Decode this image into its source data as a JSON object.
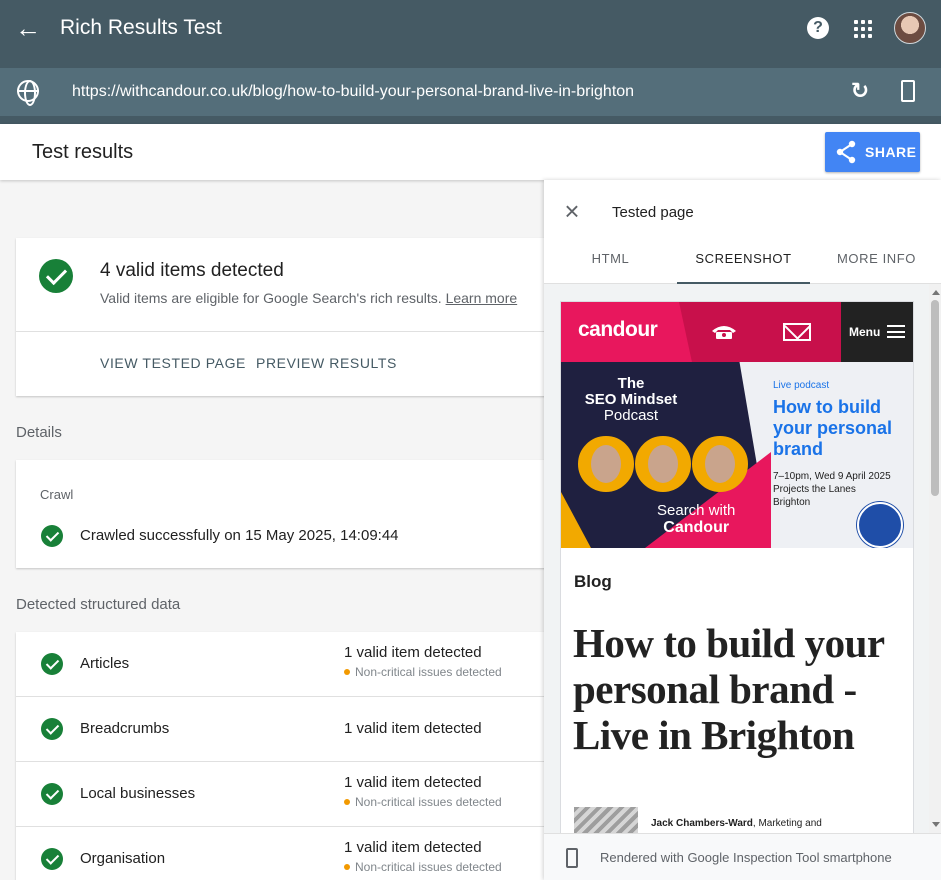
{
  "app": {
    "title": "Rich Results Test",
    "url": "https://withcandour.co.uk/blog/how-to-build-your-personal-brand-live-in-brighton",
    "help_glyph": "?",
    "back_glyph": "←",
    "reload_glyph": "↻"
  },
  "results": {
    "title": "Test results",
    "share_label": "SHARE"
  },
  "summary": {
    "headline": "4 valid items detected",
    "subtext": "Valid items are eligible for Google Search's rich results.",
    "learn_more": "Learn more",
    "view_tested_page": "VIEW TESTED PAGE",
    "preview_results": "PREVIEW RESULTS"
  },
  "details": {
    "label": "Details",
    "crawl_label": "Crawl",
    "crawl_status": "Crawled successfully on 15 May 2025, 14:09:44"
  },
  "structured_data": {
    "label": "Detected structured data",
    "rows": [
      {
        "name": "Articles",
        "status": "1 valid item detected",
        "note": "Non-critical issues detected"
      },
      {
        "name": "Breadcrumbs",
        "status": "1 valid item detected",
        "note": ""
      },
      {
        "name": "Local businesses",
        "status": "1 valid item detected",
        "note": "Non-critical issues detected"
      },
      {
        "name": "Organisation",
        "status": "1 valid item detected",
        "note": "Non-critical issues detected"
      }
    ]
  },
  "panel": {
    "title": "Tested page",
    "close_glyph": "×",
    "tabs": [
      "HTML",
      "SCREENSHOT",
      "MORE INFO"
    ],
    "active_tab": "SCREENSHOT",
    "footer": "Rendered with Google Inspection Tool smartphone"
  },
  "screenshot": {
    "logo": "candour",
    "menu_label": "Menu",
    "podcast_line1": "The",
    "podcast_line2": "SEO Mindset",
    "podcast_line3": "Podcast",
    "search_with": "Search with",
    "candour": "Candour",
    "live_label": "Live podcast",
    "podcast_headline": "How to build your personal brand",
    "event_time": "7–10pm, Wed 9 April 2025",
    "event_venue": "Projects the Lanes",
    "event_city": "Brighton",
    "section_label": "Blog",
    "post_title": "How to build your personal brand - Live in Brighton",
    "author_name": "Jack Chambers-Ward",
    "author_role": ", Marketing and"
  },
  "colors": {
    "topbar": "#455a64",
    "urlbar": "#546e7a",
    "accent_blue": "#4285f4",
    "valid_green": "#188038",
    "warning_orange": "#f29900",
    "brand_pink": "#e8175d"
  }
}
